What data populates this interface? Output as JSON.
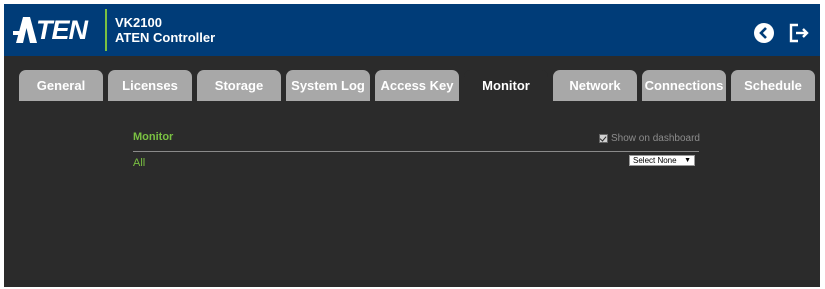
{
  "brand": {
    "logo_text": "ATEN",
    "product_model": "VK2100",
    "product_name": "ATEN Controller",
    "accent_color": "#7ac142",
    "header_color": "#003c78"
  },
  "header_icons": [
    {
      "name": "back-icon"
    },
    {
      "name": "logout-icon"
    }
  ],
  "tabs": [
    {
      "label": "General"
    },
    {
      "label": "Licenses"
    },
    {
      "label": "Storage"
    },
    {
      "label": "System Log"
    },
    {
      "label": "Access Key"
    },
    {
      "label": "Monitor",
      "active": true
    },
    {
      "label": "Network"
    },
    {
      "label": "Connections"
    },
    {
      "label": "Schedule"
    }
  ],
  "panel": {
    "title": "Monitor",
    "show_on_dashboard_label": "Show on dashboard",
    "show_on_dashboard_checked": true,
    "group_label": "All",
    "select_value": "Select None"
  }
}
